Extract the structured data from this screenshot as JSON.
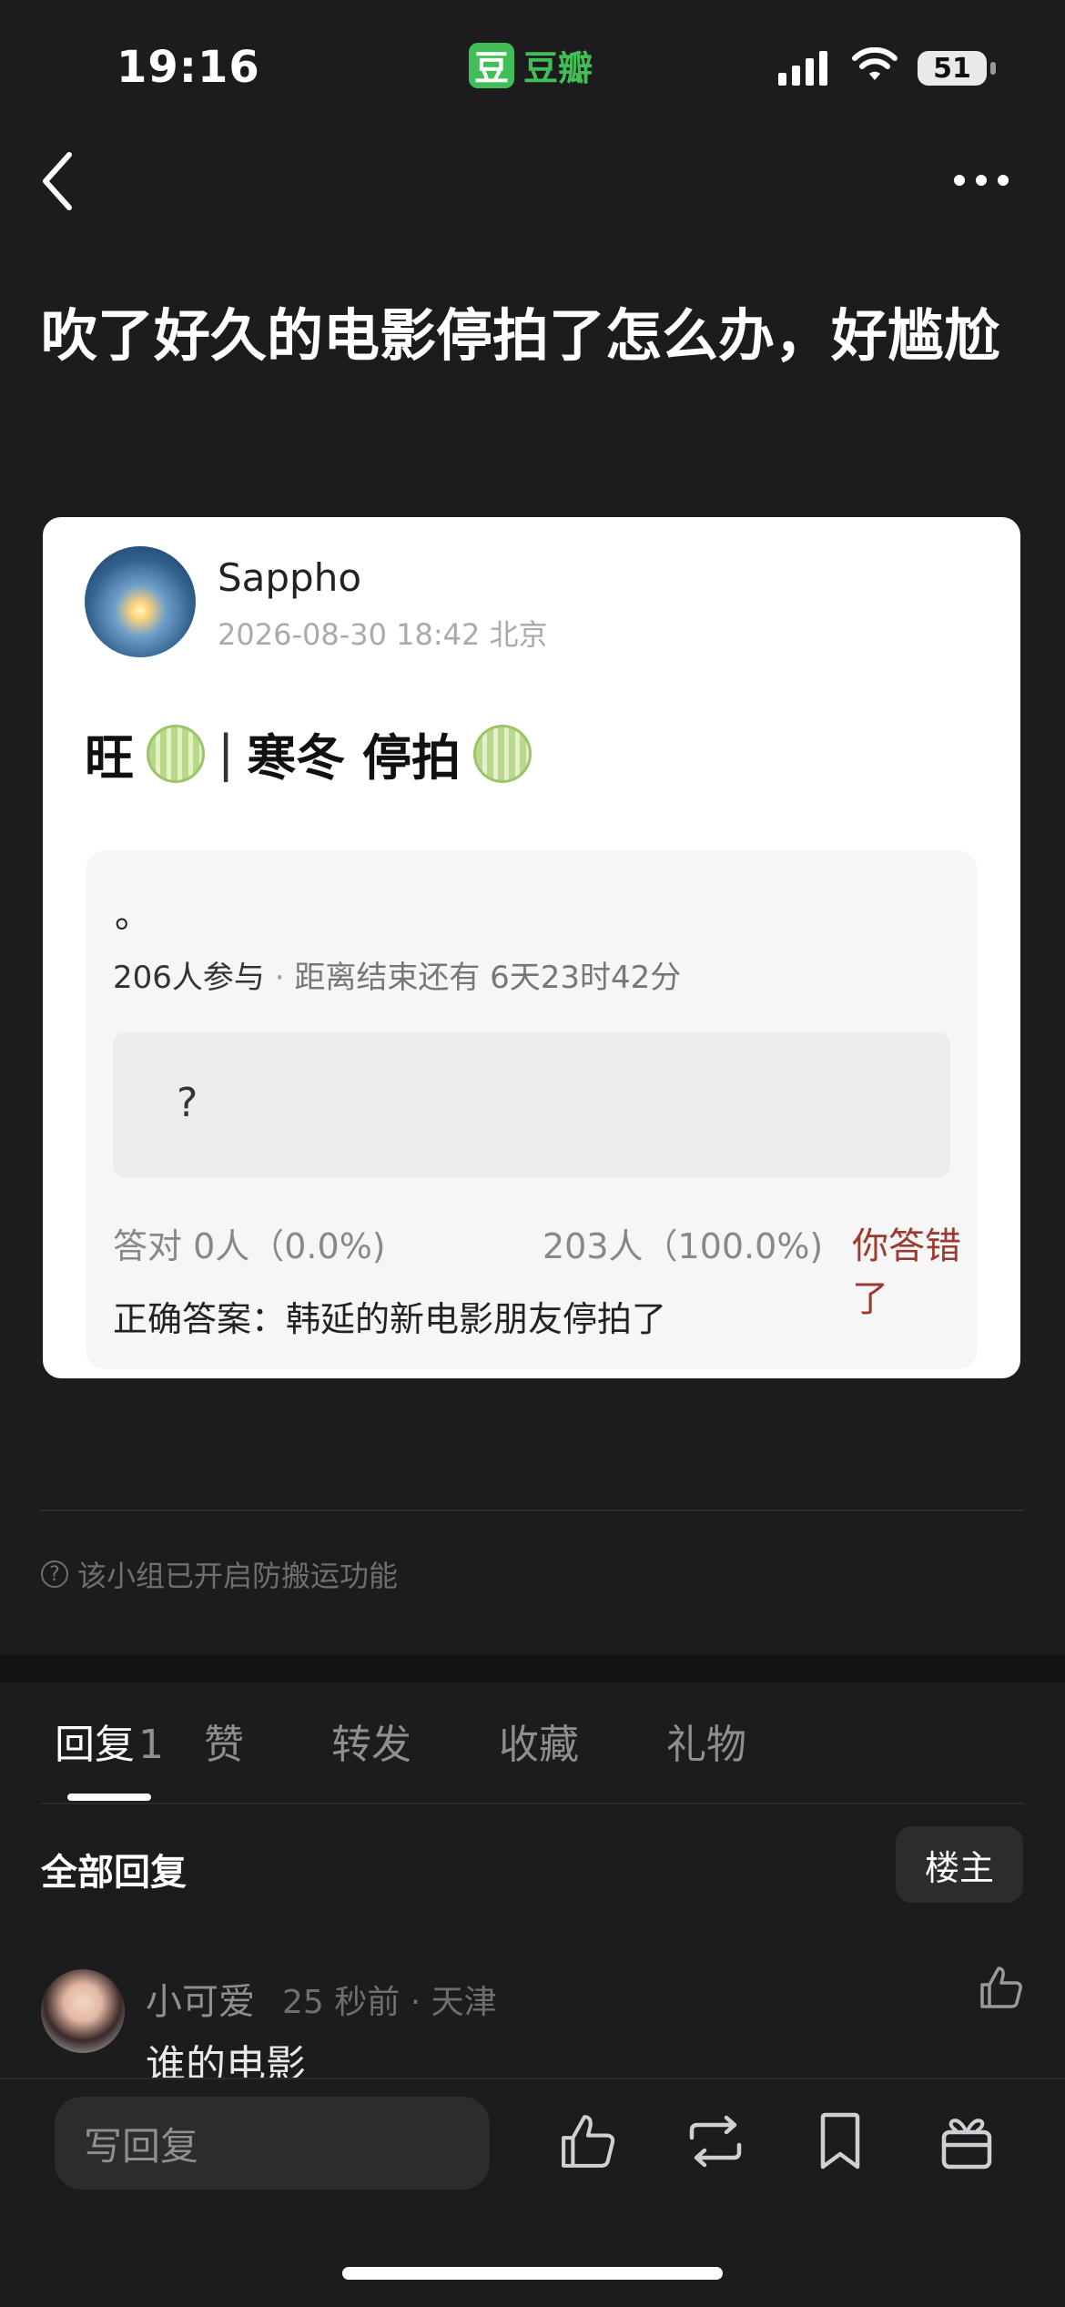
{
  "status_bar": {
    "time": "19:16",
    "app_badge": "豆",
    "app_name": "豆瓣",
    "battery": "51"
  },
  "post": {
    "title": "吹了好久的电影停拍了怎么办，好尴尬"
  },
  "card": {
    "username": "Sappho",
    "meta": "2026-08-30 18:42 北京",
    "title_part1": "旺",
    "title_bar": "|",
    "title_part2": "寒冬 停拍",
    "quiz": {
      "question_mark": "。",
      "participants": "206人参与",
      "dot": "·",
      "deadline": "距离结束还有 6天23时42分",
      "option_text": "?",
      "correct_stat": "答对  0人（0.0%)",
      "other_stat": "203人（100.0%)",
      "wrong_label": "你答错了",
      "answer": "正确答案：韩延的新电影朋友停拍了"
    }
  },
  "notice": {
    "icon": "?",
    "text": "该小组已开启防搬运功能"
  },
  "tabs": [
    {
      "label": "回复",
      "count": "1"
    },
    {
      "label": "赞"
    },
    {
      "label": "转发"
    },
    {
      "label": "收藏"
    },
    {
      "label": "礼物"
    }
  ],
  "replies": {
    "header": "全部回复",
    "op_button": "楼主",
    "items": [
      {
        "name": "小可爱",
        "meta": "25 秒前 · 天津",
        "text": "谁的电影"
      }
    ]
  },
  "bottom": {
    "reply_placeholder": "写回复"
  },
  "colors": {
    "background": "#1c1c1e",
    "brand_green": "#41be57",
    "wrong_red": "#9b3b30"
  }
}
